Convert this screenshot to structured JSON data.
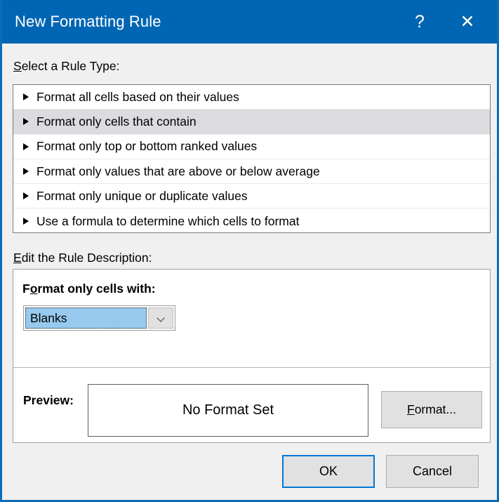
{
  "window": {
    "title": "New Formatting Rule",
    "help_icon": "question-mark-icon",
    "close_icon": "close-x-icon",
    "help_glyph": "?",
    "close_glyph": "✕",
    "accent_color": "#0066b3",
    "body_color": "#f0f0f0"
  },
  "rule_type": {
    "label_prefix": "S",
    "label_rest": "elect a Rule Type:",
    "items": [
      {
        "label": "Format all cells based on their values",
        "selected": false
      },
      {
        "label": "Format only cells that contain",
        "selected": true
      },
      {
        "label": "Format only top or bottom ranked values",
        "selected": false
      },
      {
        "label": "Format only values that are above or below average",
        "selected": false
      },
      {
        "label": "Format only unique or duplicate values",
        "selected": false
      },
      {
        "label": "Use a formula to determine which cells to format",
        "selected": false
      }
    ],
    "selected_index": 1,
    "bullet_glyph": "►",
    "selected_row_color": "#dcdce0"
  },
  "description": {
    "label_prefix": "E",
    "label_rest": "dit the Rule Description:",
    "heading_pre": "F",
    "heading_acc": "o",
    "heading_post": "rmat only cells with:",
    "combo": {
      "value": "Blanks",
      "arrow_icon": "chevron-down-icon",
      "highlight_color": "#97caee"
    },
    "preview": {
      "label": "Preview:",
      "value": "No Format Set"
    },
    "format_button": {
      "acc": "F",
      "rest": "ormat..."
    }
  },
  "footer": {
    "ok_label": "OK",
    "cancel_label": "Cancel",
    "default_button_color": "#0078d7"
  }
}
